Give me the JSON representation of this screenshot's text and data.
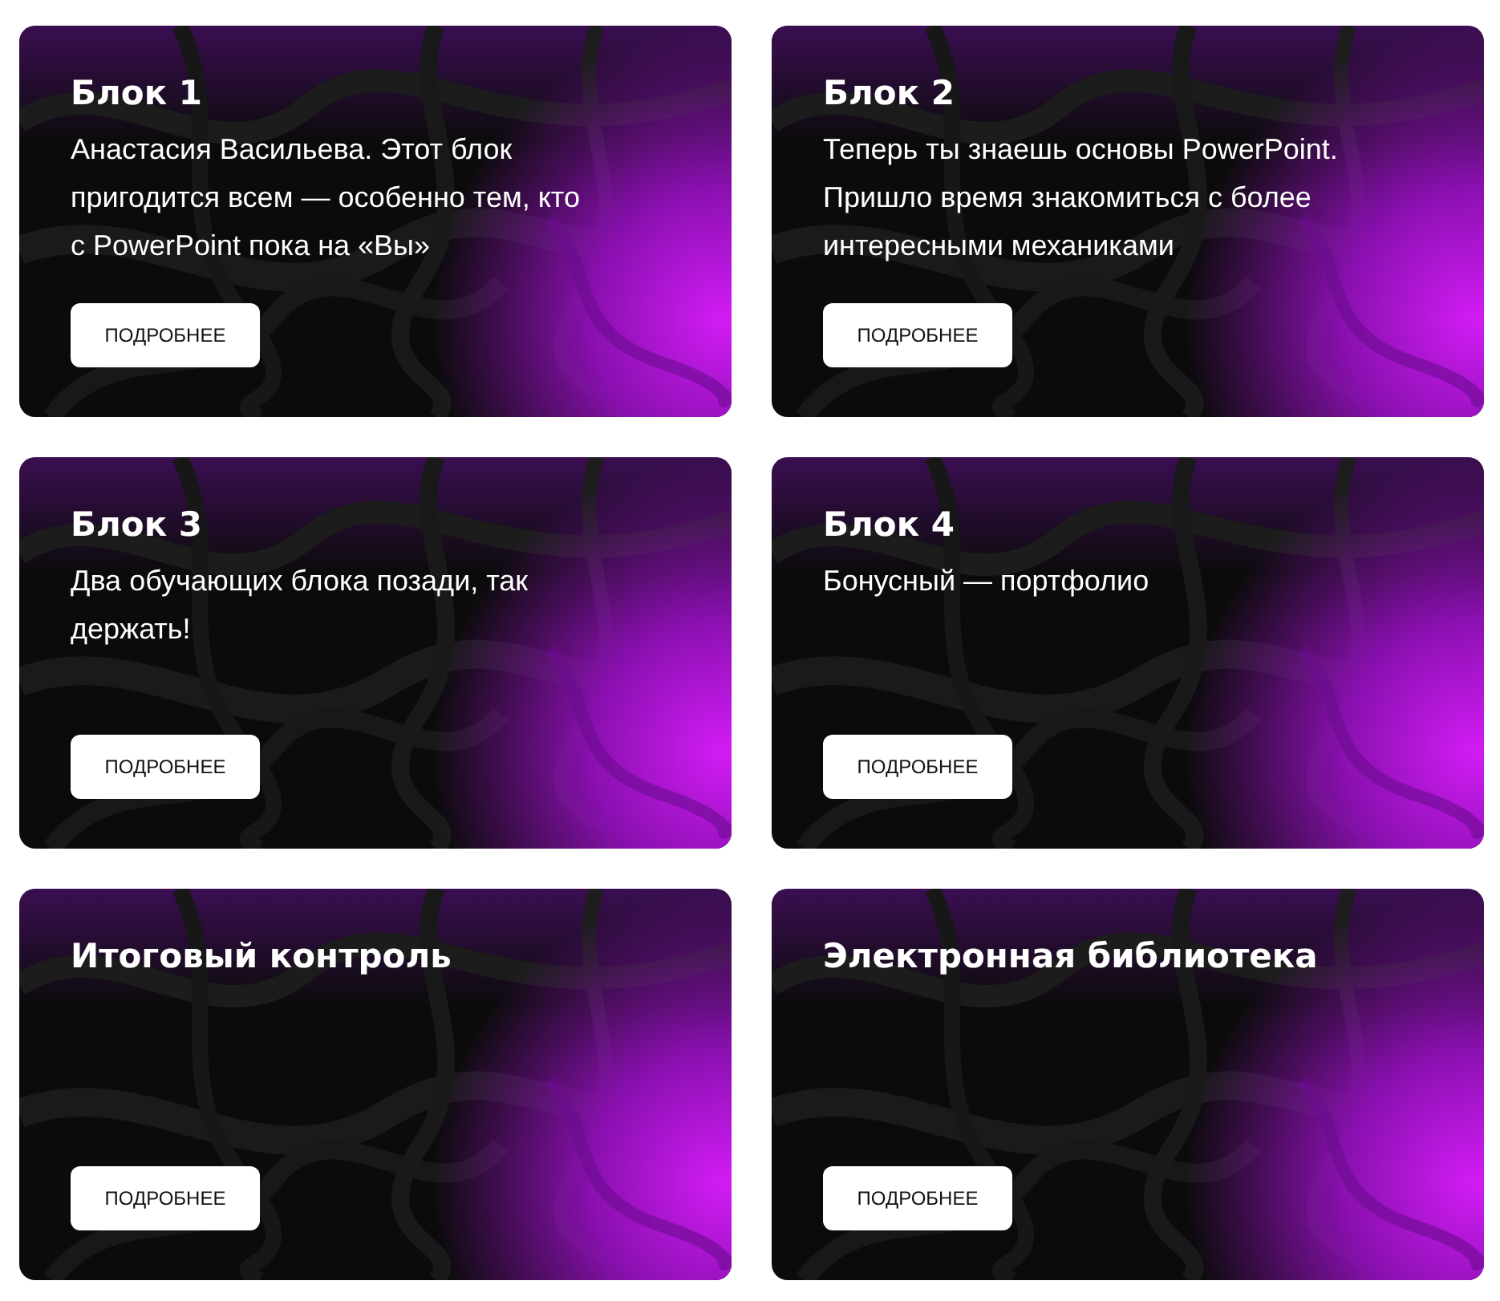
{
  "cards": [
    {
      "title": "Блок 1",
      "text": "Анастасия Васильева. Этот блок пригодится всем — особенно тем, кто с PowerPoint пока на «Вы»",
      "button": "ПОДРОБНЕЕ"
    },
    {
      "title": "Блок 2",
      "text": "Теперь ты знаешь основы PowerPoint. Пришло время знакомиться с более интересными механиками",
      "button": "ПОДРОБНЕЕ"
    },
    {
      "title": "Блок 3",
      "text": "Два обучающих блока позади, так держать!",
      "button": "ПОДРОБНЕЕ"
    },
    {
      "title": "Блок 4",
      "text": "Бонусный — портфолио",
      "button": "ПОДРОБНЕЕ"
    },
    {
      "title": "Итоговый контроль",
      "button": "ПОДРОБНЕЕ"
    },
    {
      "title": "Электронная библиотека",
      "button": "ПОДРОБНЕЕ"
    }
  ]
}
